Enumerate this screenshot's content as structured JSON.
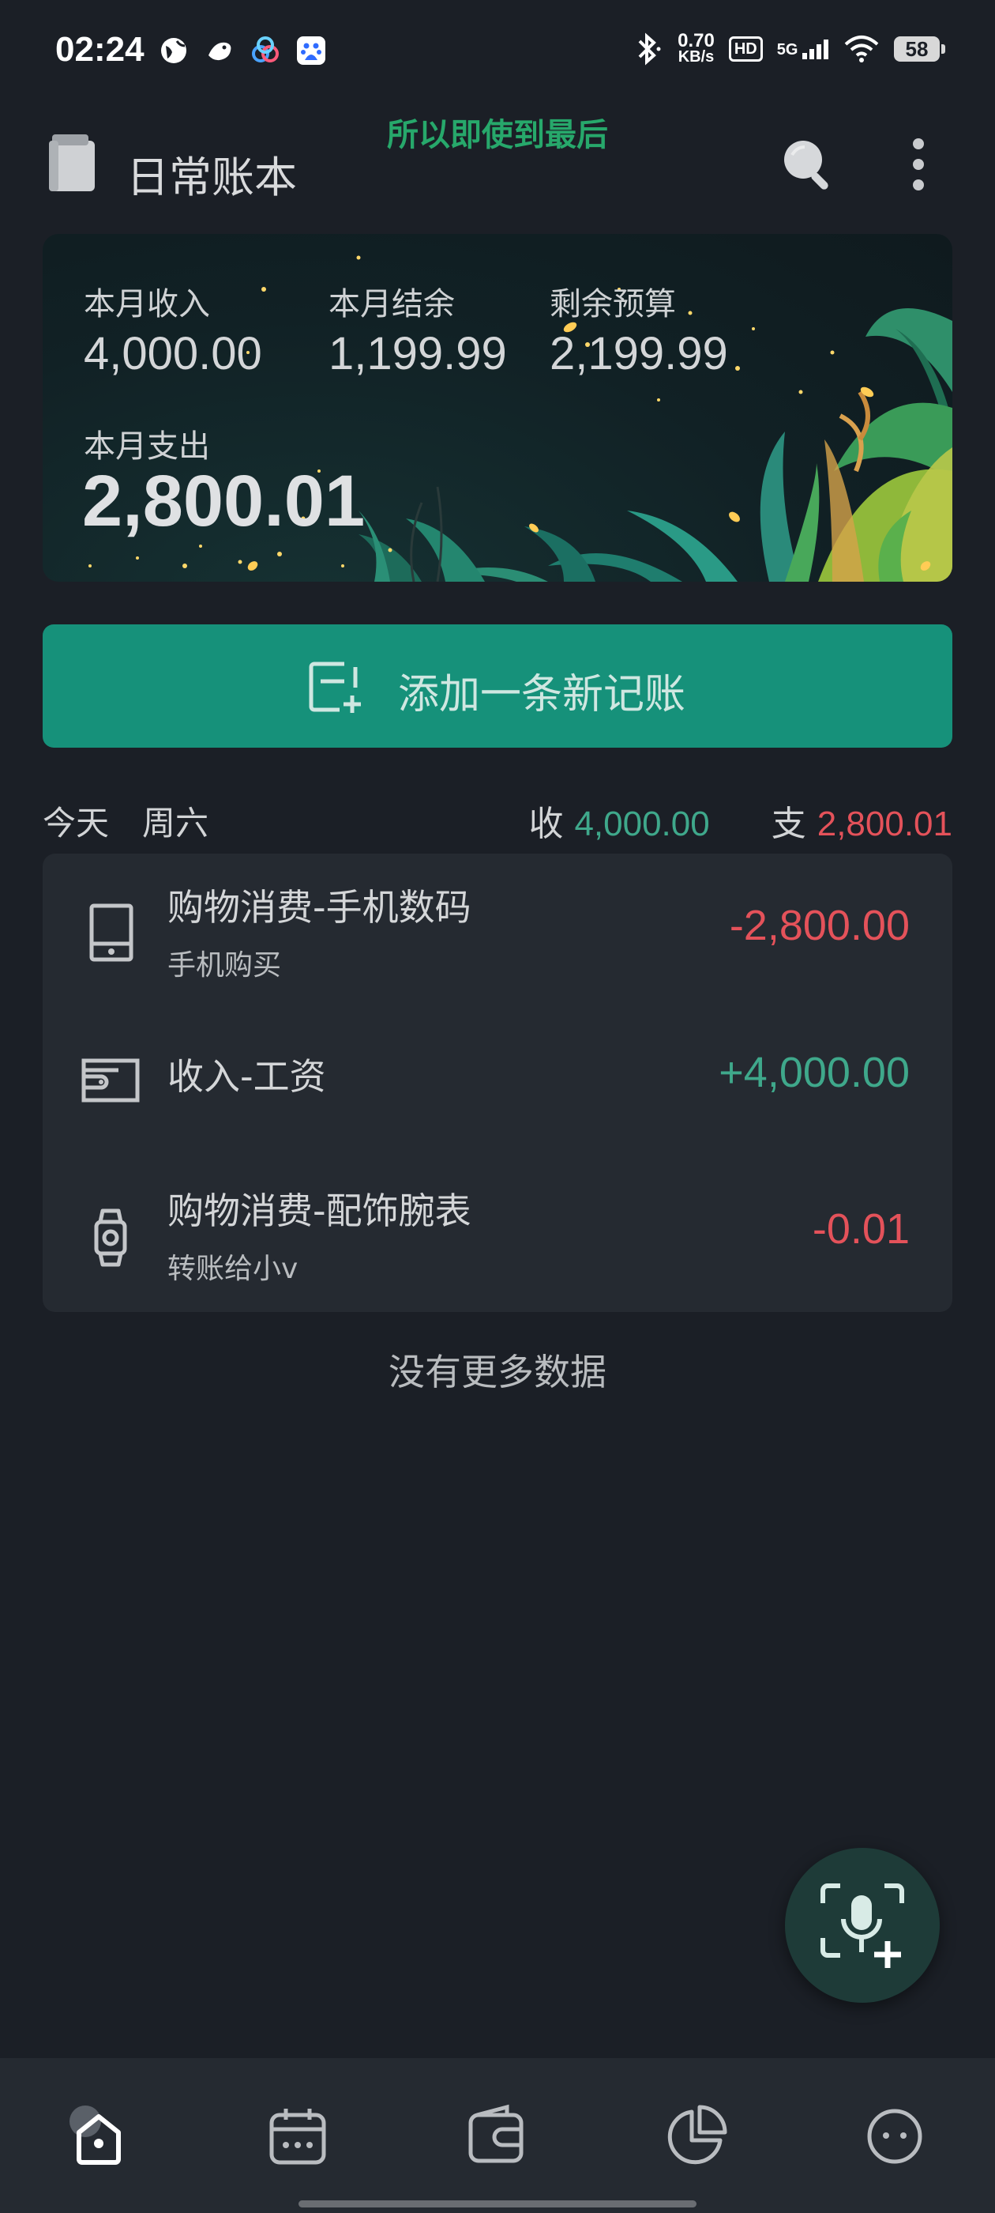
{
  "status_bar": {
    "time": "02:24",
    "net_speed_value": "0.70",
    "net_speed_unit": "KB/s",
    "hd_label": "HD",
    "network_label": "5G",
    "battery": "58"
  },
  "lyric": "所以即使到最后",
  "app_bar": {
    "title": "日常账本"
  },
  "summary": {
    "income_label": "本月收入",
    "income_value": "4,000.00",
    "balance_label": "本月结余",
    "balance_value": "1,199.99",
    "budget_label": "剩余预算",
    "budget_value": "2,199.99",
    "expense_label": "本月支出",
    "expense_value": "2,800.01"
  },
  "add_button": {
    "label": "添加一条新记账"
  },
  "day_group": {
    "day": "今天",
    "weekday": "周六",
    "income_prefix": "收",
    "income_total": "4,000.00",
    "expense_prefix": "支",
    "expense_total": "2,800.01"
  },
  "transactions": [
    {
      "icon": "tablet-icon",
      "title": "购物消费-手机数码",
      "note": "手机购买",
      "amount": "-2,800.00"
    },
    {
      "icon": "wallet-cash-icon",
      "title": "收入-工资",
      "note": "",
      "amount": "+4,000.00"
    },
    {
      "icon": "watch-icon",
      "title": "购物消费-配饰腕表",
      "note": "转账给小v",
      "amount": "-0.01"
    }
  ],
  "no_more": "没有更多数据",
  "bottom_nav": {
    "items": [
      "home-icon",
      "calendar-icon",
      "wallet-icon",
      "chart-pie-icon",
      "profile-face-icon"
    ],
    "active": "home-icon"
  },
  "colors": {
    "background": "#1b1f26",
    "accent": "#16917a",
    "income": "#3fa88b",
    "expense": "#e4525a",
    "card": "#252a31"
  }
}
